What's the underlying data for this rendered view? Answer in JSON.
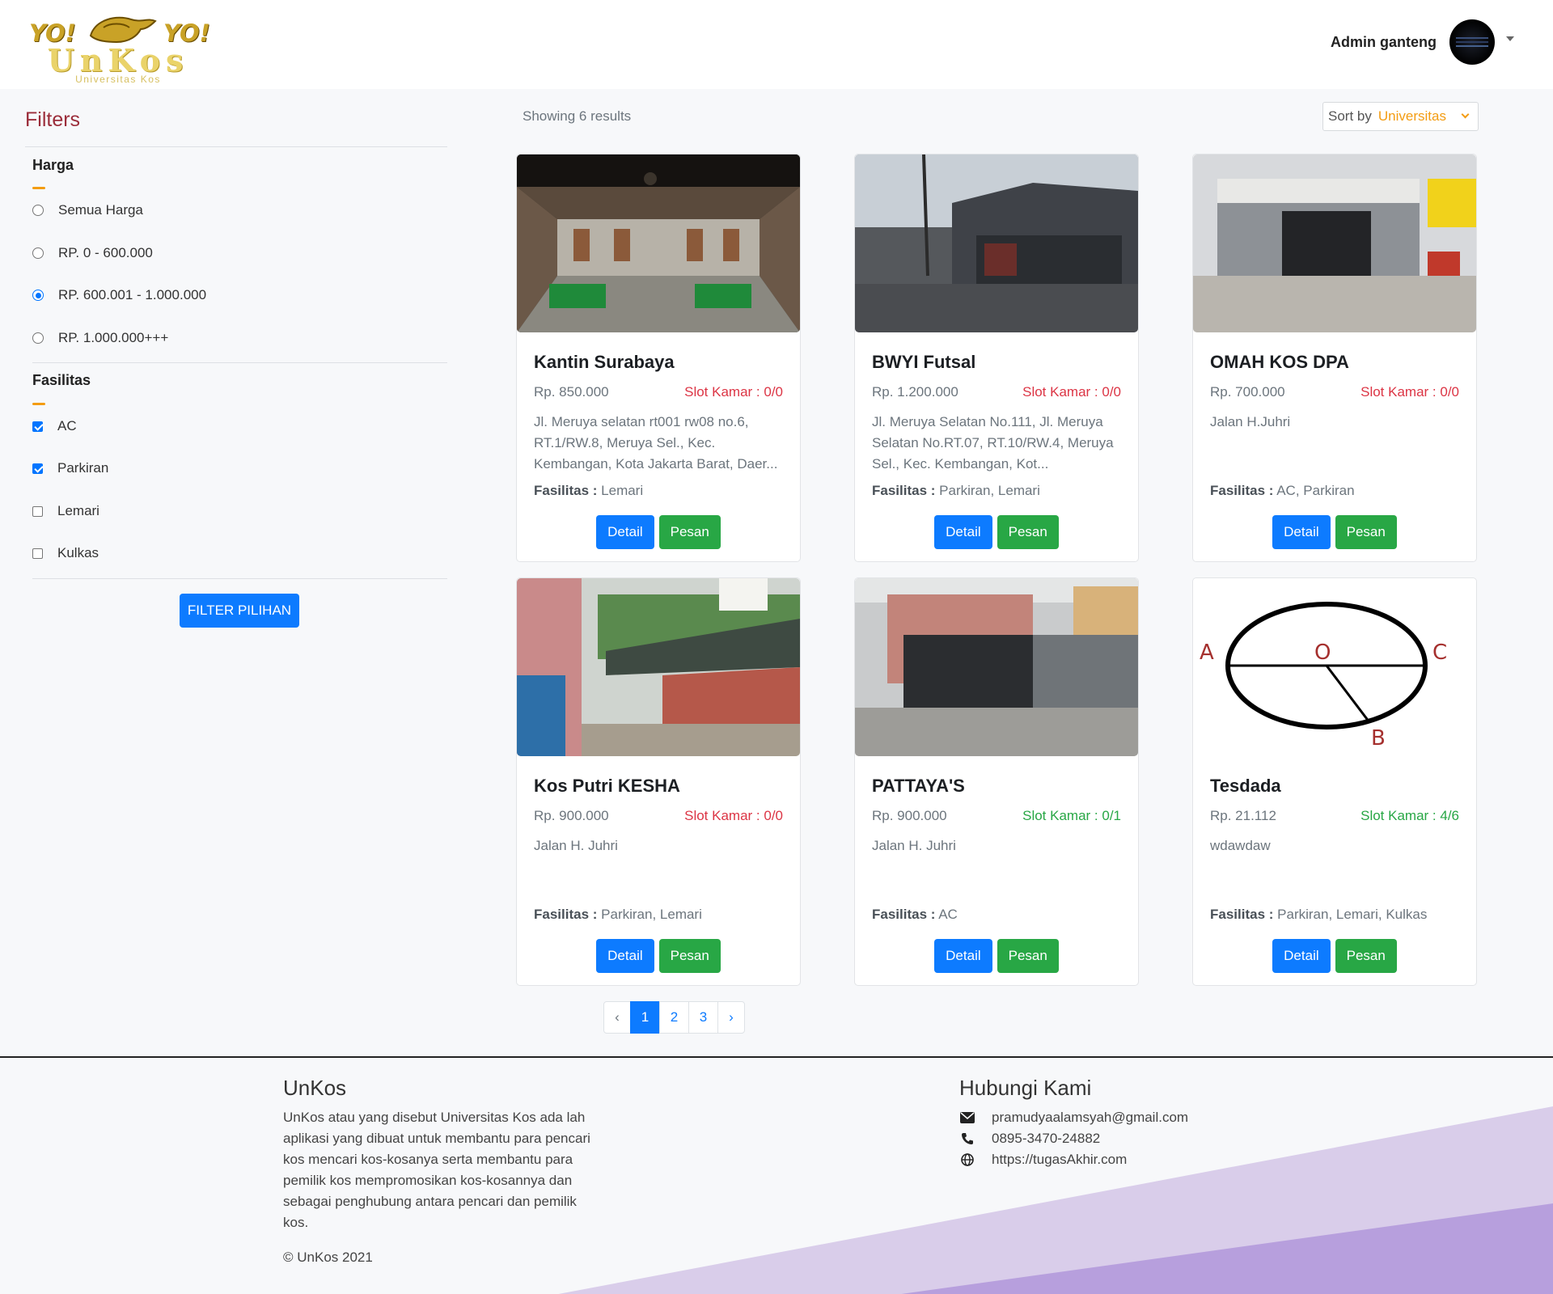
{
  "header": {
    "logo": {
      "left_text": "YO!",
      "right_text": "YO!",
      "brand": "UnKos",
      "tagline": "Universitas Kos"
    },
    "user_name": "Admin ganteng"
  },
  "filters": {
    "title": "Filters",
    "harga": {
      "title": "Harga",
      "options": [
        {
          "label": "Semua Harga",
          "selected": false
        },
        {
          "label": "RP. 0 - 600.000",
          "selected": false
        },
        {
          "label": "RP. 600.001 - 1.000.000",
          "selected": true
        },
        {
          "label": "RP. 1.000.000+++",
          "selected": false
        }
      ]
    },
    "fasilitas": {
      "title": "Fasilitas",
      "options": [
        {
          "label": "AC",
          "checked": true
        },
        {
          "label": "Parkiran",
          "checked": true
        },
        {
          "label": "Lemari",
          "checked": false
        },
        {
          "label": "Kulkas",
          "checked": false
        }
      ]
    },
    "button": "FILTER PILIHAN"
  },
  "results": {
    "showing": "Showing 6 results",
    "sort_label": "Sort by",
    "sort_value": "Universitas"
  },
  "cards": [
    {
      "title": "Kantin Surabaya",
      "price": "Rp. 850.000",
      "slot": "Slot Kamar : 0/0",
      "slot_status": "full",
      "address": "Jl. Meruya selatan rt001 rw08 no.6, RT.1/RW.8, Meruya Sel., Kec. Kembangan, Kota Jakarta Barat, Daer...",
      "fasilitas_label": "Fasilitas :",
      "fasilitas": "Lemari",
      "detail": "Detail",
      "pesan": "Pesan"
    },
    {
      "title": "BWYI Futsal",
      "price": "Rp. 1.200.000",
      "slot": "Slot Kamar : 0/0",
      "slot_status": "full",
      "address": "Jl. Meruya Selatan No.111, Jl. Meruya Selatan No.RT.07, RT.10/RW.4, Meruya Sel., Kec. Kembangan, Kot...",
      "fasilitas_label": "Fasilitas :",
      "fasilitas": "Parkiran, Lemari",
      "detail": "Detail",
      "pesan": "Pesan"
    },
    {
      "title": "OMAH KOS DPA",
      "price": "Rp. 700.000",
      "slot": "Slot Kamar : 0/0",
      "slot_status": "full",
      "address": "Jalan H.Juhri",
      "fasilitas_label": "Fasilitas :",
      "fasilitas": "AC, Parkiran",
      "detail": "Detail",
      "pesan": "Pesan"
    },
    {
      "title": "Kos Putri KESHA",
      "price": "Rp. 900.000",
      "slot": "Slot Kamar : 0/0",
      "slot_status": "full",
      "address": "Jalan H. Juhri",
      "fasilitas_label": "Fasilitas :",
      "fasilitas": "Parkiran, Lemari",
      "detail": "Detail",
      "pesan": "Pesan"
    },
    {
      "title": "PATTAYA'S",
      "price": "Rp. 900.000",
      "slot": "Slot Kamar : 0/1",
      "slot_status": "available",
      "address": "Jalan H. Juhri",
      "fasilitas_label": "Fasilitas :",
      "fasilitas": "AC",
      "detail": "Detail",
      "pesan": "Pesan"
    },
    {
      "title": "Tesdada",
      "price": "Rp. 21.112",
      "slot": "Slot Kamar : 4/6",
      "slot_status": "available",
      "address": "wdawdaw",
      "fasilitas_label": "Fasilitas :",
      "fasilitas": "Parkiran, Lemari, Kulkas",
      "detail": "Detail",
      "pesan": "Pesan"
    }
  ],
  "diagram_labels": {
    "a": "A",
    "o": "O",
    "c": "C",
    "b": "B"
  },
  "pagination": {
    "prev": "‹",
    "pages": [
      "1",
      "2",
      "3"
    ],
    "active": "1",
    "next": "›"
  },
  "footer": {
    "about_title": "UnKos",
    "about_text": "UnKos atau yang disebut Universitas Kos ada lah aplikasi yang dibuat untuk membantu para pencari kos mencari kos-kosanya serta membantu para pemilik kos mempromosikan kos-kosannya dan sebagai penghubung antara pencari dan pemilik kos.",
    "copyright": "© UnKos 2021",
    "contact_title": "Hubungi Kami",
    "email": "pramudyaalamsyah@gmail.com",
    "phone": "0895-3470-24882",
    "website": "https://tugasAkhir.com"
  },
  "colors": {
    "primary": "#0d7bff",
    "success": "#28a745",
    "danger": "#dc3545",
    "accent": "#f39c12",
    "filters_title": "#9b2d3a",
    "footer_wave_light": "#d9cdea",
    "footer_wave_dark": "#b79fdd"
  },
  "icons": {
    "user_menu": "caret-down-icon",
    "email": "envelope-icon",
    "phone": "phone-icon",
    "website": "globe-icon"
  }
}
